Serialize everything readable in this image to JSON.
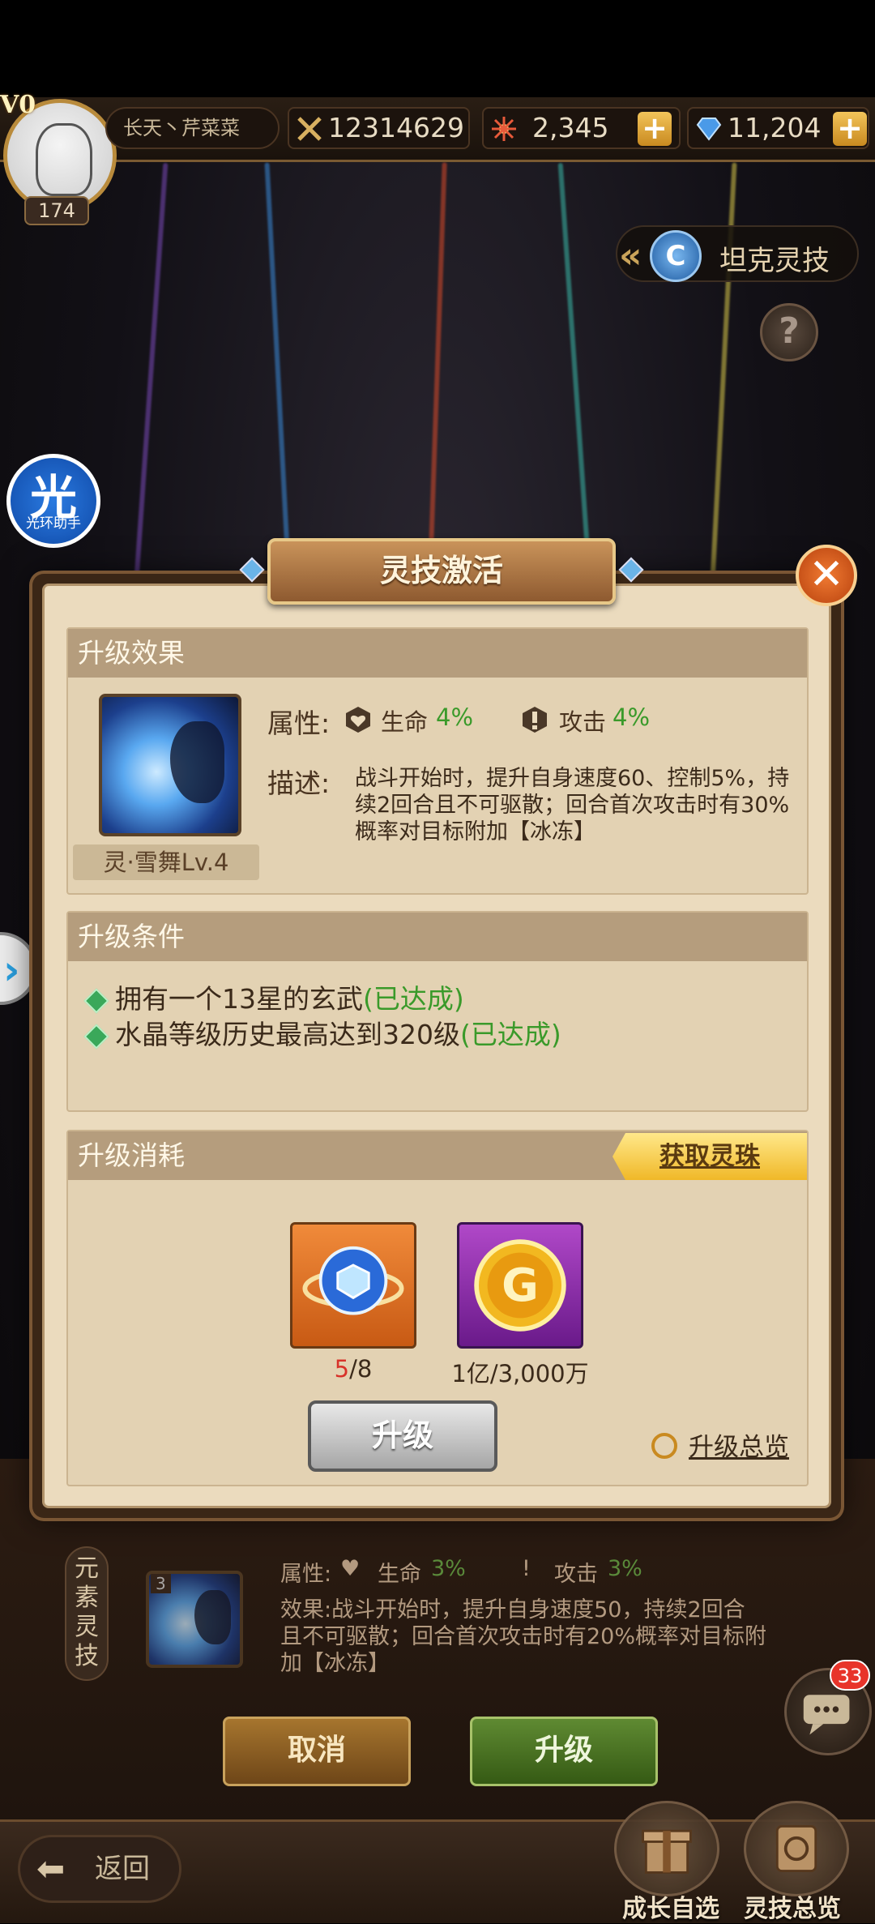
{
  "header": {
    "vip": "V0",
    "player_level": "174",
    "player_name": "长天丶芹菜菜",
    "combat_power": "12314629",
    "currency1": "2,345",
    "currency2": "11,204"
  },
  "side": {
    "tank_tab": "坦克灵技",
    "helper_char": "光",
    "helper_label": "光环助手"
  },
  "dialog": {
    "title": "灵技激活",
    "effect": {
      "heading": "升级效果",
      "skill_name": "灵·雪舞Lv.4",
      "attr_label": "属性:",
      "hp_label": "生命",
      "hp_value": "4%",
      "atk_label": "攻击",
      "atk_value": "4%",
      "desc_label": "描述:",
      "desc_text": "战斗开始时，提升自身速度60、控制5%，持续2回合且不可驱散；回合首次攻击时有30%概率对目标附加【冰冻】"
    },
    "conditions": {
      "heading": "升级条件",
      "items": [
        {
          "text": "拥有一个13星的玄武",
          "status": "(已达成)"
        },
        {
          "text": "水晶等级历史最高达到320级",
          "status": "(已达成)"
        }
      ]
    },
    "cost": {
      "heading": "升级消耗",
      "get_button": "获取灵珠",
      "item1_have": "5",
      "item1_need": "/8",
      "item2_label": "1亿/3,000万"
    },
    "upgrade_button": "升级",
    "overview_link": "升级总览"
  },
  "lower": {
    "element_label": "元素灵技",
    "skill_level": "3",
    "attr_label": "属性:",
    "hp_label": "生命",
    "hp_value": "3%",
    "atk_label": "攻击",
    "atk_value": "3%",
    "desc": "效果:战斗开始时，提升自身速度50，持续2回合且不可驱散；回合首次攻击时有20%概率对目标附加【冰冻】",
    "cancel_button": "取消",
    "upgrade_button": "升级",
    "chat_badge": "33"
  },
  "bottom": {
    "back": "返回",
    "growth": "成长自选",
    "overview": "灵技总览"
  },
  "colors": {
    "panel_bg": "#ebdbbe",
    "section_head": "#b59d7d",
    "accent_green": "#3a9a2a",
    "accent_red": "#d8322a",
    "title_plate": "#c9935a"
  }
}
